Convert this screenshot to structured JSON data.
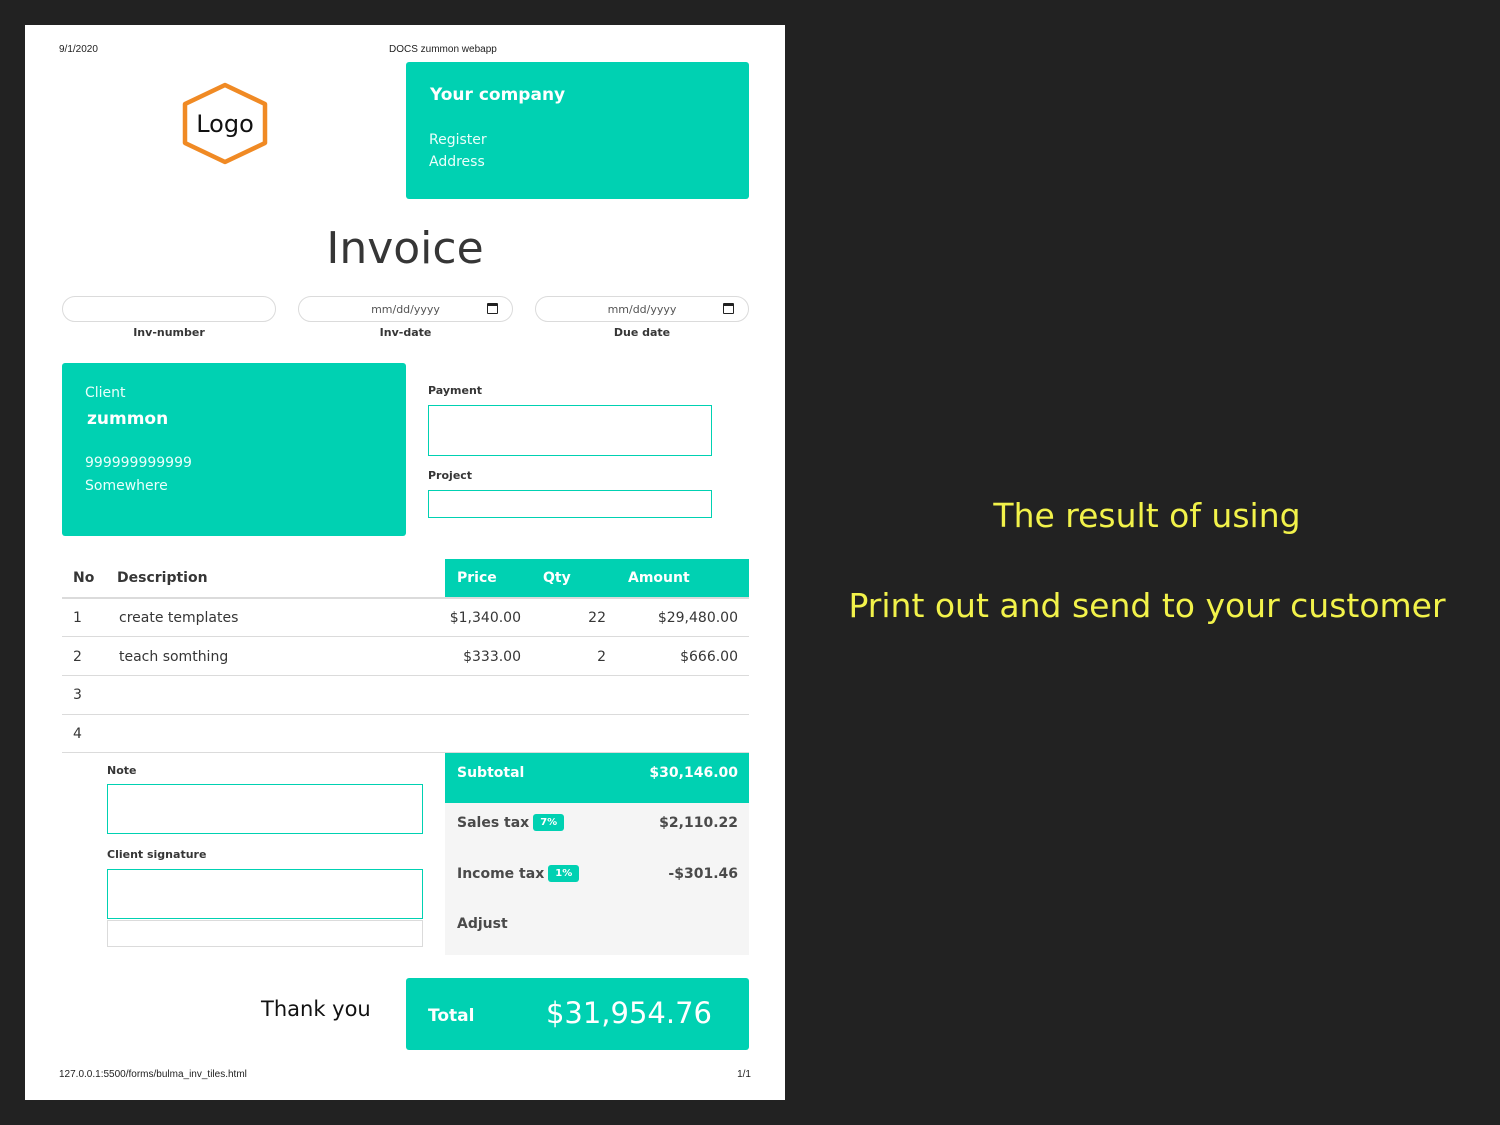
{
  "header": {
    "date": "9/1/2020",
    "doc_title": "DOCS zummon webapp"
  },
  "logo": {
    "text": "Logo",
    "stroke_color": "#f08a24"
  },
  "company": {
    "title": "Your company",
    "register": "Register",
    "address": "Address"
  },
  "invoice": {
    "title": "Invoice",
    "inv_number": {
      "label": "Inv-number",
      "value": ""
    },
    "inv_date": {
      "label": "Inv-date",
      "placeholder": "mm/dd/yyyy"
    },
    "due_date": {
      "label": "Due date",
      "placeholder": "mm/dd/yyyy"
    }
  },
  "client": {
    "label": "Client",
    "name": "zummon",
    "phone": "999999999999",
    "address": "Somewhere"
  },
  "payment": {
    "label": "Payment"
  },
  "project": {
    "label": "Project"
  },
  "table": {
    "headers": {
      "no": "No",
      "description": "Description",
      "price": "Price",
      "qty": "Qty",
      "amount": "Amount"
    },
    "rows": [
      {
        "no": "1",
        "description": "create templates",
        "price": "$1,340.00",
        "qty": "22",
        "amount": "$29,480.00"
      },
      {
        "no": "2",
        "description": "teach somthing",
        "price": "$333.00",
        "qty": "2",
        "amount": "$666.00"
      },
      {
        "no": "3",
        "description": "",
        "price": "",
        "qty": "",
        "amount": ""
      },
      {
        "no": "4",
        "description": "",
        "price": "",
        "qty": "",
        "amount": ""
      }
    ]
  },
  "note": {
    "label": "Note"
  },
  "signature": {
    "label": "Client signature"
  },
  "totals": {
    "subtotal_label": "Subtotal",
    "subtotal_value": "$30,146.00",
    "sales_tax_label": "Sales tax",
    "sales_tax_rate": "7%",
    "sales_tax_value": "$2,110.22",
    "income_tax_label": "Income tax",
    "income_tax_rate": "1%",
    "income_tax_value": "-$301.46",
    "adjust_label": "Adjust"
  },
  "thank_you": "Thank you",
  "total": {
    "label": "Total",
    "value": "$31,954.76"
  },
  "footer": {
    "url": "127.0.0.1:5500/forms/bulma_inv_tiles.html",
    "page": "1/1"
  },
  "side_text": {
    "line1": "The result of using",
    "line2": "Print out and send to your customer"
  },
  "colors": {
    "accent": "#00d1b2",
    "side_text": "#f2f24a",
    "background": "#222222"
  }
}
